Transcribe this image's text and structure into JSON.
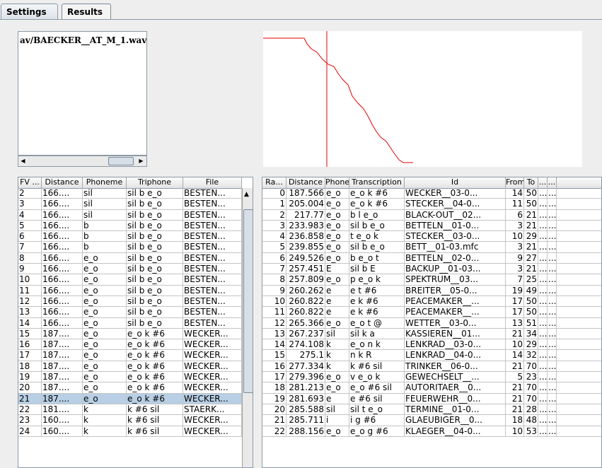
{
  "tabs": [
    {
      "label": "Settings"
    },
    {
      "label": "Results"
    }
  ],
  "file_list": {
    "items": [
      "av/BAECKER__AT_M_1.wav"
    ]
  },
  "left_table": {
    "columns": [
      "FV ...",
      "Distance",
      "Phoneme",
      "Triphone",
      "File"
    ],
    "rows": [
      [
        "2",
        "166....",
        "sil",
        "sil b e_o",
        "BESTEN..."
      ],
      [
        "3",
        "166....",
        "sil",
        "sil b e_o",
        "BESTEN..."
      ],
      [
        "4",
        "166....",
        "sil",
        "sil b e_o",
        "BESTEN..."
      ],
      [
        "5",
        "166....",
        "b",
        "sil b e_o",
        "BESTEN..."
      ],
      [
        "6",
        "166....",
        "b",
        "sil b e_o",
        "BESTEN..."
      ],
      [
        "7",
        "166....",
        "b",
        "sil b e_o",
        "BESTEN..."
      ],
      [
        "8",
        "166....",
        "e_o",
        "sil b e_o",
        "BESTEN..."
      ],
      [
        "9",
        "166....",
        "e_o",
        "sil b e_o",
        "BESTEN..."
      ],
      [
        "10",
        "166....",
        "e_o",
        "sil b e_o",
        "BESTEN..."
      ],
      [
        "11",
        "166....",
        "e_o",
        "sil b e_o",
        "BESTEN..."
      ],
      [
        "12",
        "166....",
        "e_o",
        "sil b e_o",
        "BESTEN..."
      ],
      [
        "13",
        "166....",
        "e_o",
        "sil b e_o",
        "BESTEN..."
      ],
      [
        "14",
        "166....",
        "e_o",
        "sil b e_o",
        "BESTEN..."
      ],
      [
        "15",
        "187....",
        "e_o",
        "e_o k #6",
        "WECKER..."
      ],
      [
        "16",
        "187....",
        "e_o",
        "e_o k #6",
        "WECKER..."
      ],
      [
        "17",
        "187....",
        "e_o",
        "e_o k #6",
        "WECKER..."
      ],
      [
        "18",
        "187....",
        "e_o",
        "e_o k #6",
        "WECKER..."
      ],
      [
        "19",
        "187....",
        "e_o",
        "e_o k #6",
        "WECKER..."
      ],
      [
        "20",
        "187....",
        "e_o",
        "e_o k #6",
        "WECKER..."
      ],
      [
        "21",
        "187....",
        "e_o",
        "e_o k #6",
        "WECKER..."
      ],
      [
        "22",
        "181....",
        "k",
        "k #6 sil",
        "STAERK..."
      ],
      [
        "23",
        "160....",
        "k",
        "k #6 sil",
        "WECKER..."
      ],
      [
        "24",
        "160....",
        "k",
        "k #6 sil",
        "WECKER..."
      ]
    ],
    "selected_row": "21"
  },
  "right_table": {
    "columns": [
      "Ra...",
      "Distance",
      "Phone",
      "Transcription",
      "Id",
      "From",
      "To",
      "...",
      "..."
    ],
    "rows": [
      [
        "0",
        "187.566",
        "e_o",
        "e_o k #6",
        "WECKER__03-0...",
        "14",
        "50",
        "...",
        "..."
      ],
      [
        "1",
        "205.004",
        "e_o",
        "e_o k #6",
        "STECKER__04-0...",
        "11",
        "50",
        "...",
        "..."
      ],
      [
        "2",
        "217.77",
        "e_o",
        "b l e_o",
        "BLACK-OUT__02...",
        "6",
        "21",
        "...",
        "..."
      ],
      [
        "3",
        "233.983",
        "e_o",
        "sil b e_o",
        "BETTELN__01-0...",
        "3",
        "21",
        "...",
        "..."
      ],
      [
        "4",
        "236.858",
        "e_o",
        "t e_o k",
        "STECKER__03-0...",
        "10",
        "29",
        "...",
        "..."
      ],
      [
        "5",
        "239.855",
        "e_o",
        "sil b e_o",
        "BETT__01-03.mfc",
        "3",
        "21",
        "...",
        "..."
      ],
      [
        "6",
        "249.526",
        "e_o",
        "b e_o t",
        "BETTELN__02-0...",
        "9",
        "27",
        "...",
        "..."
      ],
      [
        "7",
        "257.451",
        "E",
        "sil b E",
        "BACKUP__01-03...",
        "3",
        "21",
        "...",
        "..."
      ],
      [
        "8",
        "257.809",
        "e_o",
        "p e_o k",
        "SPEKTRUM__03...",
        "7",
        "25",
        "...",
        "..."
      ],
      [
        "9",
        "260.262",
        "e",
        "e t #6",
        "BREITER__05-0...",
        "19",
        "49",
        "...",
        "..."
      ],
      [
        "10",
        "260.822",
        "e",
        "e k #6",
        "PEACEMAKER__...",
        "17",
        "50",
        "...",
        "..."
      ],
      [
        "11",
        "260.822",
        "e",
        "e k #6",
        "PEACEMAKER__...",
        "17",
        "50",
        "...",
        "..."
      ],
      [
        "12",
        "265.366",
        "e_o",
        "e_o t @",
        "WETTER__03-0...",
        "13",
        "51",
        "...",
        "..."
      ],
      [
        "13",
        "267.237",
        "sil",
        "sil k a",
        "KASSIEREN__01...",
        "21",
        "34",
        "...",
        "..."
      ],
      [
        "14",
        "274.108",
        "k",
        "e_o n k",
        "LENKRAD__03-0...",
        "10",
        "29",
        "...",
        "..."
      ],
      [
        "15",
        "275.1",
        "k",
        "n k R",
        "LENKRAD__04-0...",
        "14",
        "32",
        "...",
        "..."
      ],
      [
        "16",
        "277.334",
        "k",
        "k #6 sil",
        "TRINKER__06-0...",
        "21",
        "70",
        "...",
        "..."
      ],
      [
        "17",
        "279.396",
        "e_o",
        "v e_o k",
        "GEWECHSELT__...",
        "5",
        "23",
        "...",
        "..."
      ],
      [
        "18",
        "281.213",
        "e_o",
        "e_o #6 sil",
        "AUTORITAER__0...",
        "21",
        "70",
        "...",
        "..."
      ],
      [
        "19",
        "281.693",
        "e",
        "e #6 sil",
        "FEUERWEHR__0...",
        "21",
        "70",
        "...",
        "..."
      ],
      [
        "20",
        "285.588",
        "sil",
        "sil t e_o",
        "TERMINE__01-0...",
        "21",
        "28",
        "...",
        "..."
      ],
      [
        "21",
        "285.711",
        "i",
        "i g #6",
        "GLAEUBIGER__0...",
        "18",
        "48",
        "...",
        "..."
      ],
      [
        "22",
        "288.156",
        "e_o",
        "e_o g #6",
        "KLAEGER__04-0...",
        "10",
        "53",
        "...",
        "..."
      ]
    ]
  },
  "colors": {
    "curve": "#e00000",
    "selection": "#b8cfe5"
  }
}
